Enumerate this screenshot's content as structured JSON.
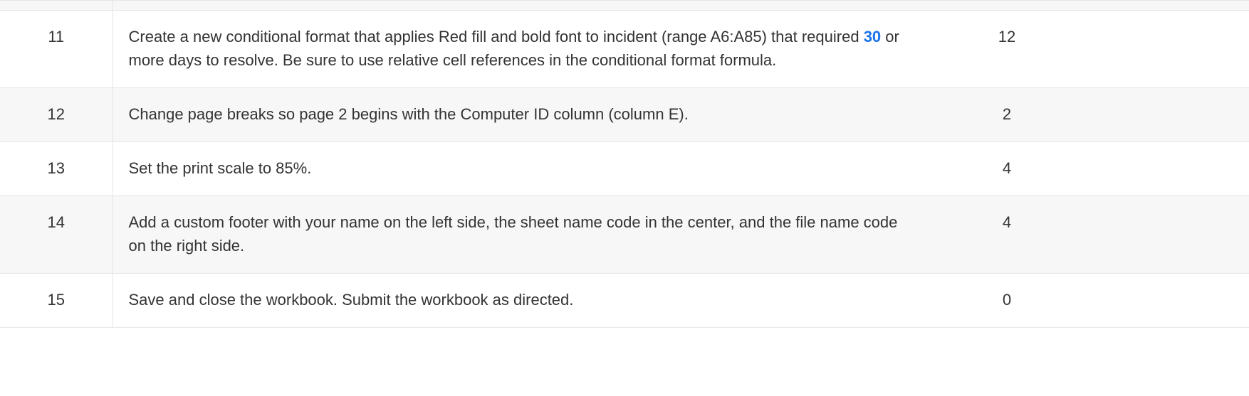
{
  "rows": [
    {
      "num": "11",
      "desc_pre": "Create a new conditional format that applies Red fill and bold font to incident (range A6:A85) that required ",
      "emph": "30",
      "desc_post": " or more days to resolve. Be sure to use relative cell references in the conditional format formula.",
      "points": "12",
      "band": "odd"
    },
    {
      "num": "12",
      "desc_pre": "Change page breaks so page 2 begins with the Computer ID column (column E).",
      "emph": "",
      "desc_post": "",
      "points": "2",
      "band": "even"
    },
    {
      "num": "13",
      "desc_pre": "Set the print scale to 85%.",
      "emph": "",
      "desc_post": "",
      "points": "4",
      "band": "odd"
    },
    {
      "num": "14",
      "desc_pre": "Add a custom footer with your name on the left side, the sheet name code in the center, and the file name code on the right side.",
      "emph": "",
      "desc_post": "",
      "points": "4",
      "band": "even"
    },
    {
      "num": "15",
      "desc_pre": "Save and close the workbook. Submit the workbook as directed.",
      "emph": "",
      "desc_post": "",
      "points": "0",
      "band": "odd"
    }
  ]
}
